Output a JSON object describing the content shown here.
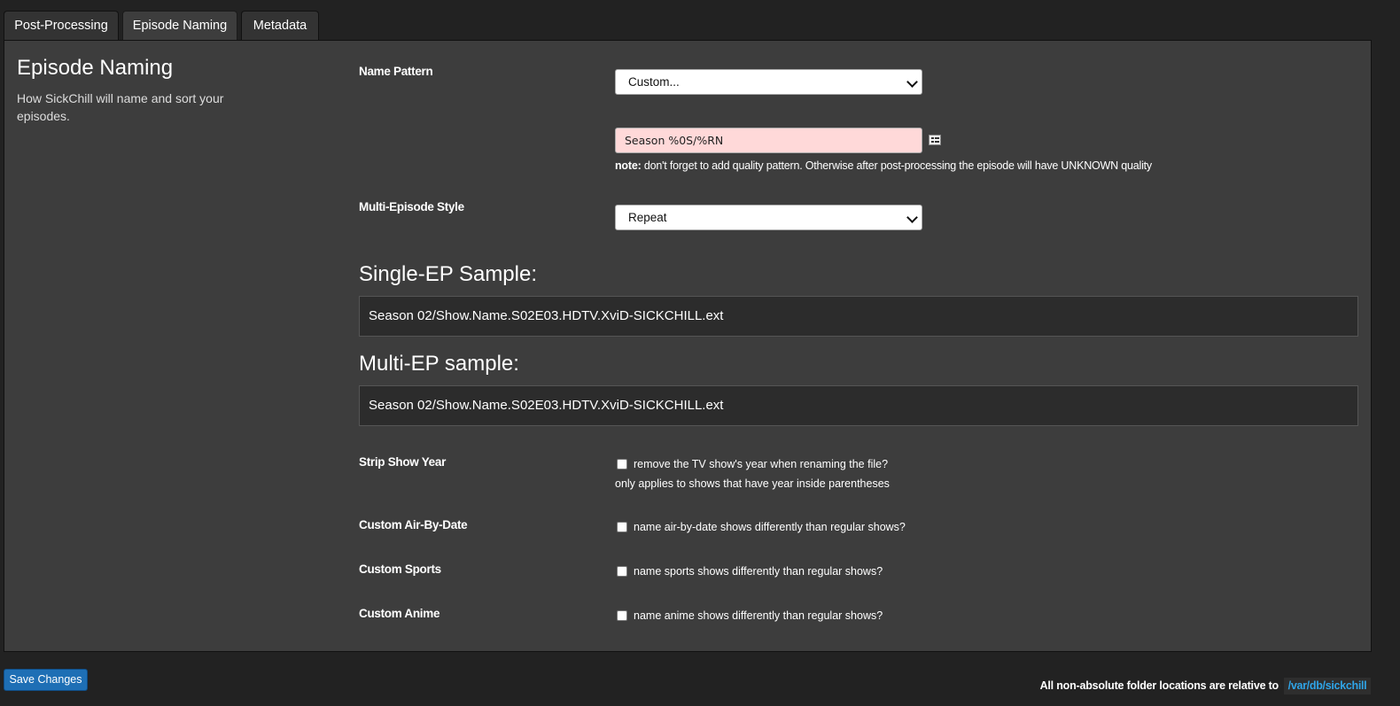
{
  "tabs": [
    {
      "label": "Post-Processing",
      "active": false
    },
    {
      "label": "Episode Naming",
      "active": true
    },
    {
      "label": "Metadata",
      "active": false
    }
  ],
  "section": {
    "title": "Episode Naming",
    "description": "How SickChill will name and sort your episodes."
  },
  "name_pattern": {
    "label": "Name Pattern",
    "selected": "Custom...",
    "custom_value": "Season %0S/%RN",
    "legend_icon": "list-icon",
    "note_prefix": "note:",
    "note_text": " don't forget to add quality pattern. Otherwise after post-processing the episode will have UNKNOWN quality"
  },
  "multi_episode": {
    "label": "Multi-Episode Style",
    "selected": "Repeat"
  },
  "single_sample": {
    "title": "Single-EP Sample:",
    "value": "Season 02/Show.Name.S02E03.HDTV.XviD-SICKCHILL.ext"
  },
  "multi_sample": {
    "title": "Multi-EP sample:",
    "value": "Season 02/Show.Name.S02E03.HDTV.XviD-SICKCHILL.ext"
  },
  "options": {
    "strip_year": {
      "label": "Strip Show Year",
      "text": "remove the TV show's year when renaming the file?",
      "subnote": "only applies to shows that have year inside parentheses",
      "checked": false
    },
    "air_by_date": {
      "label": "Custom Air-By-Date",
      "text": "name air-by-date shows differently than regular shows?",
      "checked": false
    },
    "sports": {
      "label": "Custom Sports",
      "text": "name sports shows differently than regular shows?",
      "checked": false
    },
    "anime": {
      "label": "Custom Anime",
      "text": "name anime shows differently than regular shows?",
      "checked": false
    }
  },
  "save_button": "Save Changes",
  "footer": {
    "note": "All non-absolute folder locations are relative to",
    "path": "/var/db/sickchill"
  },
  "colors": {
    "background": "#222222",
    "panel": "#3d3d3d",
    "accent": "#1e6fb5",
    "link": "#2fa4e7",
    "pattern_invalid": "#ffd9d9"
  }
}
